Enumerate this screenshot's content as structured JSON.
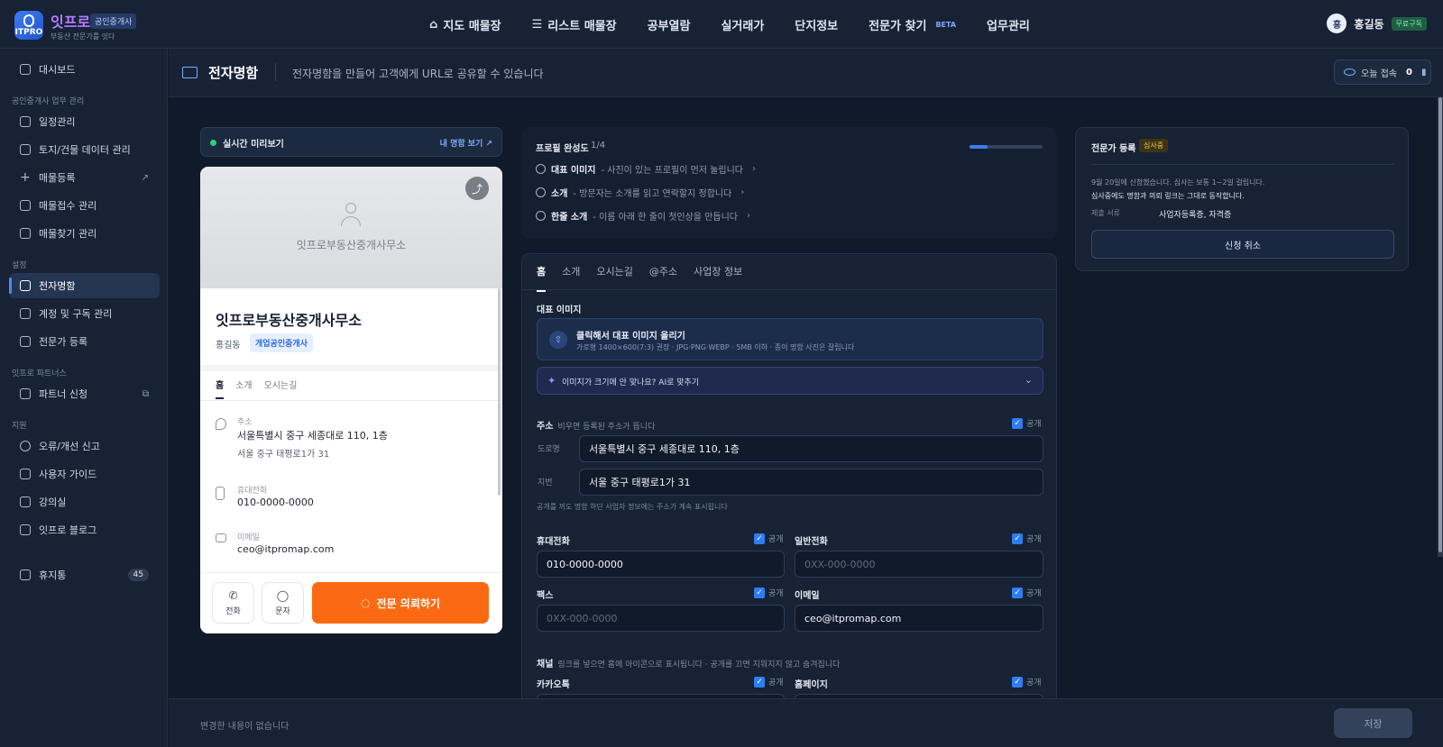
{
  "brand": {
    "name": "잇프로",
    "badge": "공인중개사",
    "tagline": "부동산 전문가를 잇다",
    "logo_text": "ITPRO"
  },
  "topnav": [
    {
      "label": "지도 매물장",
      "icon": "map-icon"
    },
    {
      "label": "리스트 매물장",
      "icon": "list-icon"
    },
    {
      "label": "공부열람"
    },
    {
      "label": "실거래가"
    },
    {
      "label": "단지정보"
    },
    {
      "label": "전문가 찾기",
      "beta": "BETA"
    },
    {
      "label": "업무관리"
    }
  ],
  "user": {
    "avatar": "홍",
    "name": "홍길동",
    "plan": "무료구독"
  },
  "sidebar": {
    "dashboard": "대시보드",
    "group1_title": "공인중개사 업무 관리",
    "group1": [
      "일정관리",
      "토지/건물 데이터 관리",
      "매물등록",
      "매물접수 관리",
      "매물찾기 관리"
    ],
    "group2_title": "설정",
    "group2": [
      "전자명함",
      "계정 및 구독 관리",
      "전문가 등록"
    ],
    "group3_title": "잇프로 파트너스",
    "group3": [
      "파트너 신청"
    ],
    "group4_title": "지원",
    "group4": [
      "오류/개선 신고",
      "사용자 가이드",
      "강의실",
      "잇프로 블로그"
    ],
    "trash": "휴지통",
    "trash_count": "45"
  },
  "subheader": {
    "title": "전자명함",
    "desc": "전자명함을 만들어 고객에게 URL로 공유할 수 있습니다",
    "visit_label": "오늘 접속",
    "visit_count": "0"
  },
  "preview": {
    "label": "실시간 미리보기",
    "link": "내 명함 보기 ↗"
  },
  "card": {
    "cover_name": "잇프로부동산중개사무소",
    "name": "잇프로부동산중개사무소",
    "owner": "홍길동",
    "role": "개업공인중개사",
    "tabs": [
      "홈",
      "소개",
      "오시는길"
    ],
    "address_label": "주소",
    "address_road": "서울특별시 중구 세종대로 110, 1층",
    "address_lot": "서울 중구 태평로1가 31",
    "mobile_label": "휴대전화",
    "mobile": "010-0000-0000",
    "email_label": "이메일",
    "email": "ceo@itpromap.com",
    "btn_call": "전화",
    "btn_sms": "문자",
    "btn_main": "전문 의뢰하기"
  },
  "profile": {
    "title": "프로필 완성도",
    "count": "1/4",
    "progress": 0.25,
    "items": [
      {
        "title": "대표 이미지",
        "desc": "- 사진이 있는 프로필이 먼저 눌립니다"
      },
      {
        "title": "소개",
        "desc": "- 방문자는 소개를 읽고 연락할지 정합니다"
      },
      {
        "title": "한줄 소개",
        "desc": "- 이름 아래 한 줄이 첫인상을 만듭니다"
      }
    ]
  },
  "form": {
    "tabs": [
      "홈",
      "소개",
      "오시는길",
      "@주소",
      "사업장 정보"
    ],
    "image_label": "대표 이미지",
    "upload_main": "클릭해서 대표 이미지 올리기",
    "upload_sub": "가로형 1400×600(7:3) 권장 · JPG·PNG·WEBP · 5MB 이하 · 종이 명함 사진은 잘립니다",
    "ai_text": "이미지가 크기에 안 맞나요? AI로 맞추기",
    "address_label": "주소",
    "address_hint": "비우면 등록된 주소가 뜹니다",
    "public": "공개",
    "road_label": "도로명",
    "road_value": "서울특별시 중구 세종대로 110, 1층",
    "lot_label": "지번",
    "lot_value": "서울 중구 태평로1가 31",
    "address_note": "공개를 꺼도 명함 하단 사업자 정보에는 주소가 계속 표시됩니다",
    "mobile_label": "휴대전화",
    "mobile_value": "010-0000-0000",
    "phone_label": "일반전화",
    "phone_placeholder": "0XX-000-0000",
    "fax_label": "팩스",
    "fax_placeholder": "0XX-000-0000",
    "email_label": "이메일",
    "email_value": "ceo@itpromap.com",
    "channel_label": "채널",
    "channel_hint": "링크를 넣으면 홈에 아이콘으로 표시됩니다 · 공개를 끄면 지워지지 않고 숨겨집니다",
    "kakao_label": "카카오톡",
    "homepage_label": "홈페이지"
  },
  "expert": {
    "title": "전문가 등록",
    "badge": "심사중",
    "line1": "9월 20일에 신청했습니다. 심사는 보통 1~2일 걸립니다.",
    "line2": "심사중에도 명함과 의뢰 링크는 그대로 동작합니다.",
    "doc_label": "제출 서류",
    "doc_value": "사업자등록증, 자격증",
    "cancel": "신청 취소"
  },
  "footer": {
    "message": "변경한 내용이 없습니다",
    "save": "저장"
  }
}
